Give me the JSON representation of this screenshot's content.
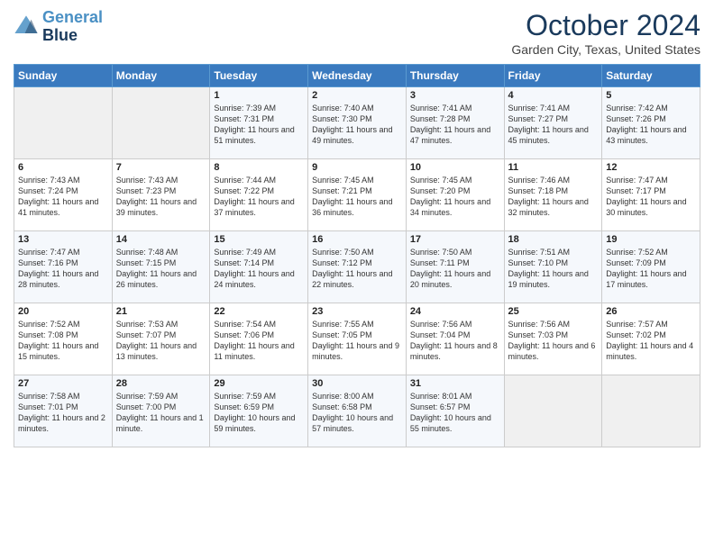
{
  "header": {
    "logo_line1": "General",
    "logo_line2": "Blue",
    "month_title": "October 2024",
    "subtitle": "Garden City, Texas, United States"
  },
  "weekdays": [
    "Sunday",
    "Monday",
    "Tuesday",
    "Wednesday",
    "Thursday",
    "Friday",
    "Saturday"
  ],
  "weeks": [
    [
      {
        "day": "",
        "info": ""
      },
      {
        "day": "",
        "info": ""
      },
      {
        "day": "1",
        "info": "Sunrise: 7:39 AM\nSunset: 7:31 PM\nDaylight: 11 hours and 51 minutes."
      },
      {
        "day": "2",
        "info": "Sunrise: 7:40 AM\nSunset: 7:30 PM\nDaylight: 11 hours and 49 minutes."
      },
      {
        "day": "3",
        "info": "Sunrise: 7:41 AM\nSunset: 7:28 PM\nDaylight: 11 hours and 47 minutes."
      },
      {
        "day": "4",
        "info": "Sunrise: 7:41 AM\nSunset: 7:27 PM\nDaylight: 11 hours and 45 minutes."
      },
      {
        "day": "5",
        "info": "Sunrise: 7:42 AM\nSunset: 7:26 PM\nDaylight: 11 hours and 43 minutes."
      }
    ],
    [
      {
        "day": "6",
        "info": "Sunrise: 7:43 AM\nSunset: 7:24 PM\nDaylight: 11 hours and 41 minutes."
      },
      {
        "day": "7",
        "info": "Sunrise: 7:43 AM\nSunset: 7:23 PM\nDaylight: 11 hours and 39 minutes."
      },
      {
        "day": "8",
        "info": "Sunrise: 7:44 AM\nSunset: 7:22 PM\nDaylight: 11 hours and 37 minutes."
      },
      {
        "day": "9",
        "info": "Sunrise: 7:45 AM\nSunset: 7:21 PM\nDaylight: 11 hours and 36 minutes."
      },
      {
        "day": "10",
        "info": "Sunrise: 7:45 AM\nSunset: 7:20 PM\nDaylight: 11 hours and 34 minutes."
      },
      {
        "day": "11",
        "info": "Sunrise: 7:46 AM\nSunset: 7:18 PM\nDaylight: 11 hours and 32 minutes."
      },
      {
        "day": "12",
        "info": "Sunrise: 7:47 AM\nSunset: 7:17 PM\nDaylight: 11 hours and 30 minutes."
      }
    ],
    [
      {
        "day": "13",
        "info": "Sunrise: 7:47 AM\nSunset: 7:16 PM\nDaylight: 11 hours and 28 minutes."
      },
      {
        "day": "14",
        "info": "Sunrise: 7:48 AM\nSunset: 7:15 PM\nDaylight: 11 hours and 26 minutes."
      },
      {
        "day": "15",
        "info": "Sunrise: 7:49 AM\nSunset: 7:14 PM\nDaylight: 11 hours and 24 minutes."
      },
      {
        "day": "16",
        "info": "Sunrise: 7:50 AM\nSunset: 7:12 PM\nDaylight: 11 hours and 22 minutes."
      },
      {
        "day": "17",
        "info": "Sunrise: 7:50 AM\nSunset: 7:11 PM\nDaylight: 11 hours and 20 minutes."
      },
      {
        "day": "18",
        "info": "Sunrise: 7:51 AM\nSunset: 7:10 PM\nDaylight: 11 hours and 19 minutes."
      },
      {
        "day": "19",
        "info": "Sunrise: 7:52 AM\nSunset: 7:09 PM\nDaylight: 11 hours and 17 minutes."
      }
    ],
    [
      {
        "day": "20",
        "info": "Sunrise: 7:52 AM\nSunset: 7:08 PM\nDaylight: 11 hours and 15 minutes."
      },
      {
        "day": "21",
        "info": "Sunrise: 7:53 AM\nSunset: 7:07 PM\nDaylight: 11 hours and 13 minutes."
      },
      {
        "day": "22",
        "info": "Sunrise: 7:54 AM\nSunset: 7:06 PM\nDaylight: 11 hours and 11 minutes."
      },
      {
        "day": "23",
        "info": "Sunrise: 7:55 AM\nSunset: 7:05 PM\nDaylight: 11 hours and 9 minutes."
      },
      {
        "day": "24",
        "info": "Sunrise: 7:56 AM\nSunset: 7:04 PM\nDaylight: 11 hours and 8 minutes."
      },
      {
        "day": "25",
        "info": "Sunrise: 7:56 AM\nSunset: 7:03 PM\nDaylight: 11 hours and 6 minutes."
      },
      {
        "day": "26",
        "info": "Sunrise: 7:57 AM\nSunset: 7:02 PM\nDaylight: 11 hours and 4 minutes."
      }
    ],
    [
      {
        "day": "27",
        "info": "Sunrise: 7:58 AM\nSunset: 7:01 PM\nDaylight: 11 hours and 2 minutes."
      },
      {
        "day": "28",
        "info": "Sunrise: 7:59 AM\nSunset: 7:00 PM\nDaylight: 11 hours and 1 minute."
      },
      {
        "day": "29",
        "info": "Sunrise: 7:59 AM\nSunset: 6:59 PM\nDaylight: 10 hours and 59 minutes."
      },
      {
        "day": "30",
        "info": "Sunrise: 8:00 AM\nSunset: 6:58 PM\nDaylight: 10 hours and 57 minutes."
      },
      {
        "day": "31",
        "info": "Sunrise: 8:01 AM\nSunset: 6:57 PM\nDaylight: 10 hours and 55 minutes."
      },
      {
        "day": "",
        "info": ""
      },
      {
        "day": "",
        "info": ""
      }
    ]
  ]
}
